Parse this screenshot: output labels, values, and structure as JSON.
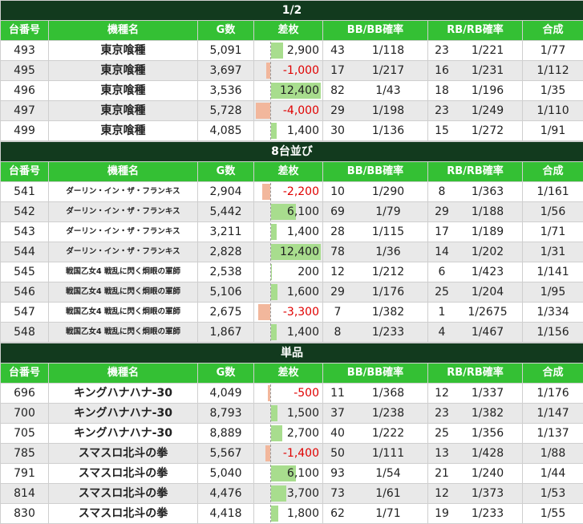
{
  "headers": [
    "台番号",
    "機種名",
    "G数",
    "差枚",
    "BB/BB確率",
    "RB/RB確率",
    "合成"
  ],
  "diff_scale_max": 12400,
  "colors": {
    "title_bg": "#123a1e",
    "header_bg": "#34c034",
    "positive_bar": "#a8dd8e",
    "negative_bar": "#f2b79c",
    "negative_text": "#e00000"
  },
  "sections": [
    {
      "title": "1/2",
      "rows": [
        {
          "no": "493",
          "model": "東京喰種",
          "games": "5,091",
          "diff": "2,900",
          "diff_value": 2900,
          "bb": "43",
          "bb_rate": "1/118",
          "rb": "23",
          "rb_rate": "1/221",
          "combined": "1/77"
        },
        {
          "no": "495",
          "model": "東京喰種",
          "games": "3,697",
          "diff": "-1,000",
          "diff_value": -1000,
          "bb": "17",
          "bb_rate": "1/217",
          "rb": "16",
          "rb_rate": "1/231",
          "combined": "1/112"
        },
        {
          "no": "496",
          "model": "東京喰種",
          "games": "3,536",
          "diff": "12,400",
          "diff_value": 12400,
          "bb": "82",
          "bb_rate": "1/43",
          "rb": "18",
          "rb_rate": "1/196",
          "combined": "1/35"
        },
        {
          "no": "497",
          "model": "東京喰種",
          "games": "5,728",
          "diff": "-4,000",
          "diff_value": -4000,
          "bb": "29",
          "bb_rate": "1/198",
          "rb": "23",
          "rb_rate": "1/249",
          "combined": "1/110"
        },
        {
          "no": "499",
          "model": "東京喰種",
          "games": "4,085",
          "diff": "1,400",
          "diff_value": 1400,
          "bb": "30",
          "bb_rate": "1/136",
          "rb": "15",
          "rb_rate": "1/272",
          "combined": "1/91"
        }
      ]
    },
    {
      "title": "8台並び",
      "rows": [
        {
          "no": "541",
          "model": "ダーリン・イン・ザ・フランキス",
          "games": "2,904",
          "diff": "-2,200",
          "diff_value": -2200,
          "bb": "10",
          "bb_rate": "1/290",
          "rb": "8",
          "rb_rate": "1/363",
          "combined": "1/161"
        },
        {
          "no": "542",
          "model": "ダーリン・イン・ザ・フランキス",
          "games": "5,442",
          "diff": "6,100",
          "diff_value": 6100,
          "bb": "69",
          "bb_rate": "1/79",
          "rb": "29",
          "rb_rate": "1/188",
          "combined": "1/56"
        },
        {
          "no": "543",
          "model": "ダーリン・イン・ザ・フランキス",
          "games": "3,211",
          "diff": "1,400",
          "diff_value": 1400,
          "bb": "28",
          "bb_rate": "1/115",
          "rb": "17",
          "rb_rate": "1/189",
          "combined": "1/71"
        },
        {
          "no": "544",
          "model": "ダーリン・イン・ザ・フランキス",
          "games": "2,828",
          "diff": "12,400",
          "diff_value": 12400,
          "bb": "78",
          "bb_rate": "1/36",
          "rb": "14",
          "rb_rate": "1/202",
          "combined": "1/31"
        },
        {
          "no": "545",
          "model": "戦国乙女4 戦乱に閃く炯眼の軍師",
          "games": "2,538",
          "diff": "200",
          "diff_value": 200,
          "bb": "12",
          "bb_rate": "1/212",
          "rb": "6",
          "rb_rate": "1/423",
          "combined": "1/141"
        },
        {
          "no": "546",
          "model": "戦国乙女4 戦乱に閃く炯眼の軍師",
          "games": "5,106",
          "diff": "1,600",
          "diff_value": 1600,
          "bb": "29",
          "bb_rate": "1/176",
          "rb": "25",
          "rb_rate": "1/204",
          "combined": "1/95"
        },
        {
          "no": "547",
          "model": "戦国乙女4 戦乱に閃く炯眼の軍師",
          "games": "2,675",
          "diff": "-3,300",
          "diff_value": -3300,
          "bb": "7",
          "bb_rate": "1/382",
          "rb": "1",
          "rb_rate": "1/2675",
          "combined": "1/334"
        },
        {
          "no": "548",
          "model": "戦国乙女4 戦乱に閃く炯眼の軍師",
          "games": "1,867",
          "diff": "1,400",
          "diff_value": 1400,
          "bb": "8",
          "bb_rate": "1/233",
          "rb": "4",
          "rb_rate": "1/467",
          "combined": "1/156"
        }
      ]
    },
    {
      "title": "単品",
      "rows": [
        {
          "no": "696",
          "model": "キングハナハナ-30",
          "games": "4,049",
          "diff": "-500",
          "diff_value": -500,
          "bb": "11",
          "bb_rate": "1/368",
          "rb": "12",
          "rb_rate": "1/337",
          "combined": "1/176"
        },
        {
          "no": "700",
          "model": "キングハナハナ-30",
          "games": "8,793",
          "diff": "1,500",
          "diff_value": 1500,
          "bb": "37",
          "bb_rate": "1/238",
          "rb": "23",
          "rb_rate": "1/382",
          "combined": "1/147"
        },
        {
          "no": "705",
          "model": "キングハナハナ-30",
          "games": "8,889",
          "diff": "2,700",
          "diff_value": 2700,
          "bb": "40",
          "bb_rate": "1/222",
          "rb": "25",
          "rb_rate": "1/356",
          "combined": "1/137"
        },
        {
          "no": "785",
          "model": "スマスロ北斗の拳",
          "games": "5,567",
          "diff": "-1,400",
          "diff_value": -1400,
          "bb": "50",
          "bb_rate": "1/111",
          "rb": "13",
          "rb_rate": "1/428",
          "combined": "1/88"
        },
        {
          "no": "791",
          "model": "スマスロ北斗の拳",
          "games": "5,040",
          "diff": "6,100",
          "diff_value": 6100,
          "bb": "93",
          "bb_rate": "1/54",
          "rb": "21",
          "rb_rate": "1/240",
          "combined": "1/44"
        },
        {
          "no": "814",
          "model": "スマスロ北斗の拳",
          "games": "4,476",
          "diff": "3,700",
          "diff_value": 3700,
          "bb": "73",
          "bb_rate": "1/61",
          "rb": "12",
          "rb_rate": "1/373",
          "combined": "1/53"
        },
        {
          "no": "830",
          "model": "スマスロ北斗の拳",
          "games": "4,418",
          "diff": "1,800",
          "diff_value": 1800,
          "bb": "62",
          "bb_rate": "1/71",
          "rb": "19",
          "rb_rate": "1/233",
          "combined": "1/55"
        }
      ]
    }
  ]
}
